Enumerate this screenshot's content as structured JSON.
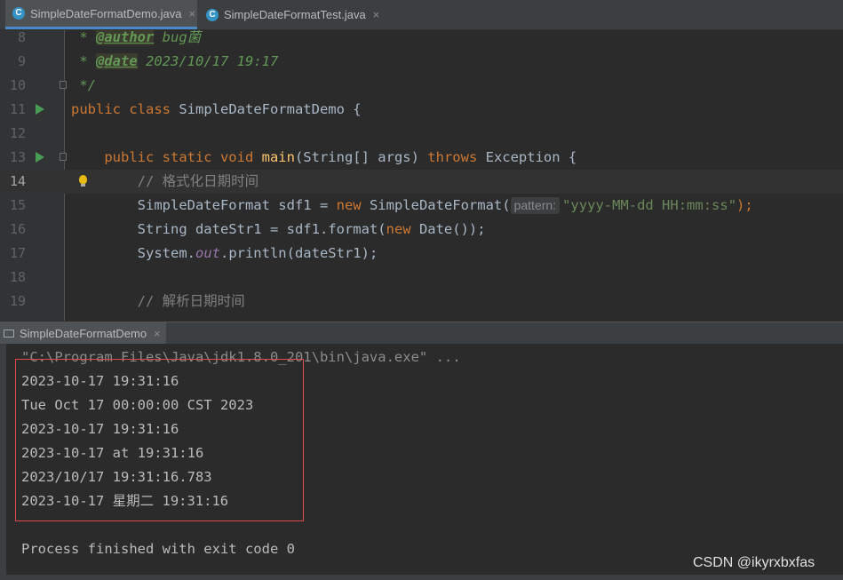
{
  "tabs": [
    {
      "label": "SimpleDateFormatDemo.java",
      "active": true
    },
    {
      "label": "SimpleDateFormatTest.java",
      "active": false
    }
  ],
  "editor": {
    "line_numbers": [
      "8",
      "9",
      "10",
      "11",
      "12",
      "13",
      "14",
      "15",
      "16",
      "17",
      "18",
      "19"
    ],
    "current_line": "14",
    "lines": {
      "l8_star": " * ",
      "l8_tag": "@author",
      "l8_text": " bug菌",
      "l9_star": " * ",
      "l9_tag": "@date",
      "l9_text": " 2023/10/17 19:17",
      "l10": " */",
      "l11_kw": "public class ",
      "l11_text": "SimpleDateFormatDemo {",
      "l13_indent": "    ",
      "l13_kw": "public static void ",
      "l13_fn": "main",
      "l13_args": "(String[] args) ",
      "l13_throws": "throws ",
      "l13_rest": "Exception {",
      "l14_comment": "        // 格式化日期时间",
      "l15_a": "        SimpleDateFormat sdf1 = ",
      "l15_new": "new ",
      "l15_b": "SimpleDateFormat(",
      "l15_hint": "pattern:",
      "l15_str": "\"yyyy-MM-dd HH:mm:ss\"",
      "l15_end": ");",
      "l16_a": "        String dateStr1 = sdf1.format(",
      "l16_new": "new ",
      "l16_b": "Date());",
      "l17_a": "        System.",
      "l17_out": "out",
      "l17_b": ".println(dateStr1);",
      "l19_comment": "        // 解析日期时间"
    }
  },
  "console": {
    "tab_label": "SimpleDateFormatDemo",
    "command": "\"C:\\Program Files\\Java\\jdk1.8.0_201\\bin\\java.exe\" ...",
    "output": [
      "2023-10-17 19:31:16",
      "Tue Oct 17 00:00:00 CST 2023",
      "2023-10-17 19:31:16",
      "2023-10-17 at 19:31:16",
      "2023/10/17 19:31:16.783",
      "2023-10-17 星期二 19:31:16"
    ],
    "exit": "Process finished with exit code 0"
  },
  "watermark": "CSDN @ikyrxbxfas",
  "colors": {
    "accent": "#4a88c7",
    "highlight_box": "#e04a4a",
    "keyword": "#cc7832",
    "string": "#6a8759"
  }
}
